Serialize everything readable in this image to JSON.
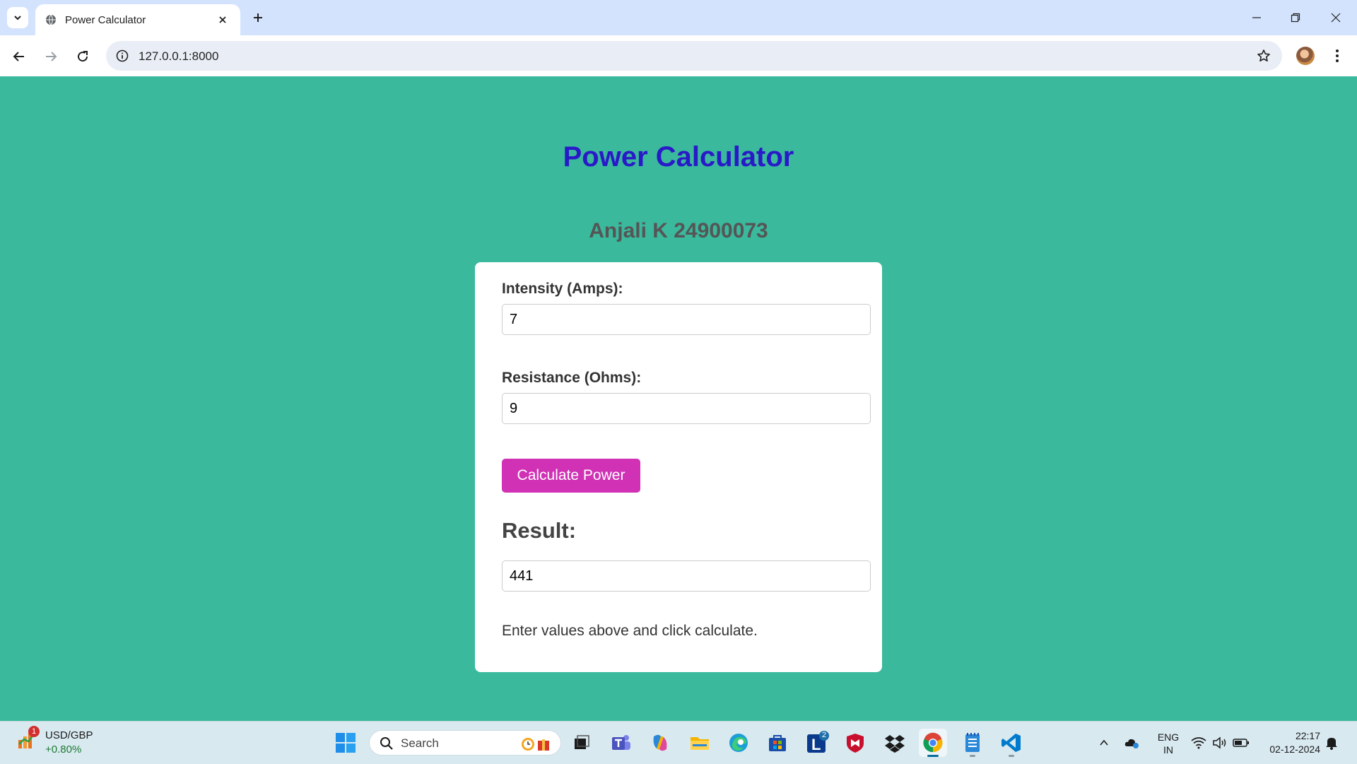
{
  "browser": {
    "tab_title": "Power Calculator",
    "url": "127.0.0.1:8000"
  },
  "page": {
    "title": "Power Calculator",
    "subtitle": "Anjali K 24900073",
    "intensity_label": "Intensity (Amps):",
    "intensity_value": "7",
    "resistance_label": "Resistance (Ohms):",
    "resistance_value": "9",
    "calculate_button": "Calculate Power",
    "result_heading": "Result:",
    "result_value": "441",
    "hint": "Enter values above and click calculate."
  },
  "colors": {
    "page_background": "#3ab99d",
    "title": "#2a19c8",
    "button": "#d031b5"
  },
  "taskbar": {
    "widget_title": "USD/GBP",
    "widget_change": "+0.80%",
    "widget_badge": "1",
    "search_label": "Search",
    "app_badge_count": "2",
    "language_line1": "ENG",
    "language_line2": "IN",
    "time": "22:17",
    "date": "02-12-2024",
    "pinned_icons": [
      "start-icon",
      "copilot-icon",
      "task-view-icon",
      "teams-icon",
      "copilot-app-icon",
      "file-explorer-icon",
      "edge-icon",
      "store-icon",
      "linkedin-icon",
      "mcafee-icon",
      "dropbox-icon",
      "chrome-icon",
      "notepad-icon",
      "vscode-icon"
    ]
  }
}
